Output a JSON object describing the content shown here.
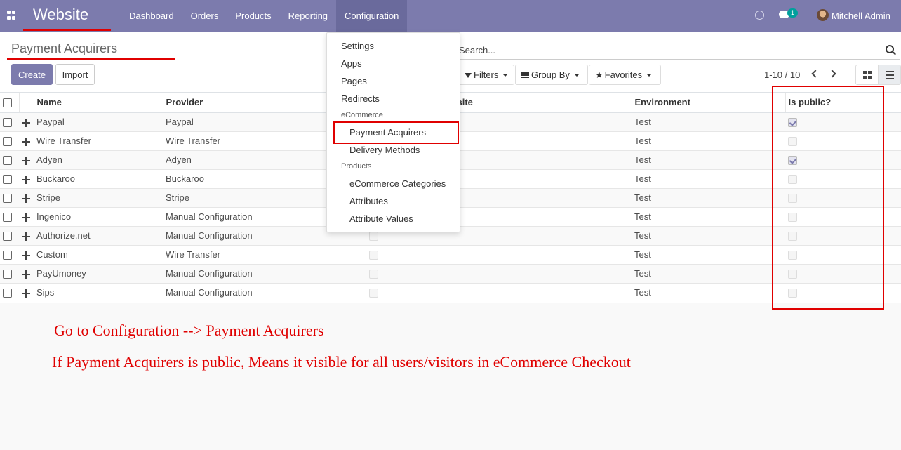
{
  "navbar": {
    "brand": "Website",
    "menu": [
      "Dashboard",
      "Orders",
      "Products",
      "Reporting",
      "Configuration"
    ],
    "chat_count": "1",
    "user": "Mitchell Admin"
  },
  "control_panel": {
    "title": "Payment Acquirers",
    "create": "Create",
    "import": "Import",
    "search_placeholder": "Search...",
    "filters": "Filters",
    "group_by": "Group By",
    "favorites": "Favorites",
    "pager": "1-10 / 10"
  },
  "dropdown": {
    "settings": "Settings",
    "apps": "Apps",
    "pages": "Pages",
    "redirects": "Redirects",
    "header_ecommerce": "eCommerce",
    "payment_acquirers": "Payment Acquirers",
    "delivery_methods": "Delivery Methods",
    "header_products": "Products",
    "ecommerce_categories": "eCommerce Categories",
    "attributes": "Attributes",
    "attribute_values": "Attribute Values"
  },
  "table": {
    "headers": {
      "name": "Name",
      "provider": "Provider",
      "website": "site",
      "environment": "Environment",
      "is_public": "Is public?"
    },
    "rows": [
      {
        "name": "Paypal",
        "provider": "Paypal",
        "environment": "Test"
      },
      {
        "name": "Wire Transfer",
        "provider": "Wire Transfer",
        "environment": "Test"
      },
      {
        "name": "Adyen",
        "provider": "Adyen",
        "environment": "Test"
      },
      {
        "name": "Buckaroo",
        "provider": "Buckaroo",
        "environment": "Test"
      },
      {
        "name": "Stripe",
        "provider": "Stripe",
        "environment": "Test"
      },
      {
        "name": "Ingenico",
        "provider": "Manual Configuration",
        "environment": "Test"
      },
      {
        "name": "Authorize.net",
        "provider": "Manual Configuration",
        "environment": "Test"
      },
      {
        "name": "Custom",
        "provider": "Wire Transfer",
        "environment": "Test"
      },
      {
        "name": "PayUmoney",
        "provider": "Manual Configuration",
        "environment": "Test"
      },
      {
        "name": "Sips",
        "provider": "Manual Configuration",
        "environment": "Test"
      }
    ]
  },
  "annotations": {
    "line1": "Go to Configuration --> Payment Acquirers",
    "line2": "If Payment Acquirers is public, Means it visible for all users/visitors in eCommerce Checkout"
  },
  "colors": {
    "navbar": "#7c7bad",
    "highlight": "#e00000"
  }
}
